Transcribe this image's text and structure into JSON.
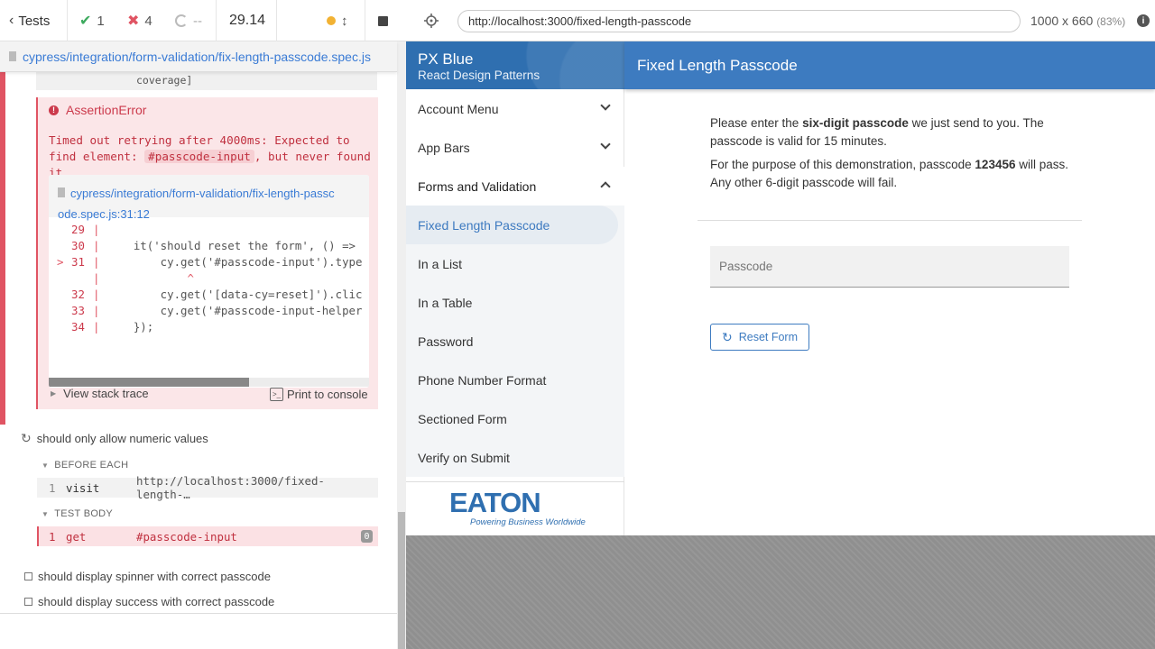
{
  "reporter": {
    "tests_label": "Tests",
    "passed_count": "1",
    "failed_count": "4",
    "pending_count": "--",
    "duration": "29.14",
    "spec_path": "cypress/integration/form-validation/fix-length-passcode.spec.js",
    "coverage_text": "coverage]",
    "error": {
      "title": "AssertionError",
      "message_pre": "Timed out retrying after 4000ms: Expected to find element: ",
      "message_code": "#passcode-input",
      "message_post": ", but never found it.",
      "file_line1": "cypress/integration/form-validation/fix-length-passc",
      "file_line2": "ode.spec.js:31:12",
      "code": [
        {
          "num": "29",
          "arrow": "",
          "src": ""
        },
        {
          "num": "30",
          "arrow": "",
          "src": "    it('should reset the form', () =>"
        },
        {
          "num": "31",
          "arrow": ">",
          "src": "        cy.get('#passcode-input').type"
        },
        {
          "num": "",
          "arrow": "",
          "src": "            ^"
        },
        {
          "num": "32",
          "arrow": "",
          "src": "        cy.get('[data-cy=reset]').clic"
        },
        {
          "num": "33",
          "arrow": "",
          "src": "        cy.get('#passcode-input-helper"
        },
        {
          "num": "34",
          "arrow": "",
          "src": "    });"
        }
      ],
      "view_stack_trace": "View stack trace",
      "print_to_console": "Print to console"
    },
    "test_numeric": "should only allow numeric values",
    "before_each_label": "BEFORE EACH",
    "visit_row": {
      "index": "1",
      "cmd": "visit",
      "arg": "http://localhost:3000/fixed-length-…"
    },
    "test_body_label": "TEST BODY",
    "get_row": {
      "index": "1",
      "cmd": "get",
      "arg": "#passcode-input",
      "badge": "0"
    },
    "test_spinner": "should display spinner with correct passcode",
    "test_success": "should display success with correct passcode"
  },
  "browser": {
    "url": "http://localhost:3000/fixed-length-passcode",
    "viewport": "1000 x 660",
    "scale": "(83%)"
  },
  "app": {
    "drawer_title": "PX Blue",
    "drawer_subtitle": "React Design Patterns",
    "nav": {
      "account_menu": "Account Menu",
      "app_bars": "App Bars",
      "forms_and_validation": "Forms and Validation",
      "fixed_length_passcode": "Fixed Length Passcode",
      "in_a_list": "In a List",
      "in_a_table": "In a Table",
      "password": "Password",
      "phone_number_format": "Phone Number Format",
      "sectioned_form": "Sectioned Form",
      "verify_on_submit": "Verify on Submit"
    },
    "logo_word": "EATON",
    "logo_tagline": "Powering Business Worldwide",
    "page_title": "Fixed Length Passcode",
    "intro1_pre": "Please enter the ",
    "intro1_bold": "six-digit passcode",
    "intro1_post": " we just send to you. The passcode is valid for 15 minutes.",
    "intro2_pre": "For the purpose of this demonstration, passcode ",
    "intro2_bold": "123456",
    "intro2_post": " will pass. Any other 6-digit passcode will fail.",
    "passcode_placeholder": "Passcode",
    "reset_label": "Reset Form",
    "brand_color": "#3d7bc0"
  }
}
